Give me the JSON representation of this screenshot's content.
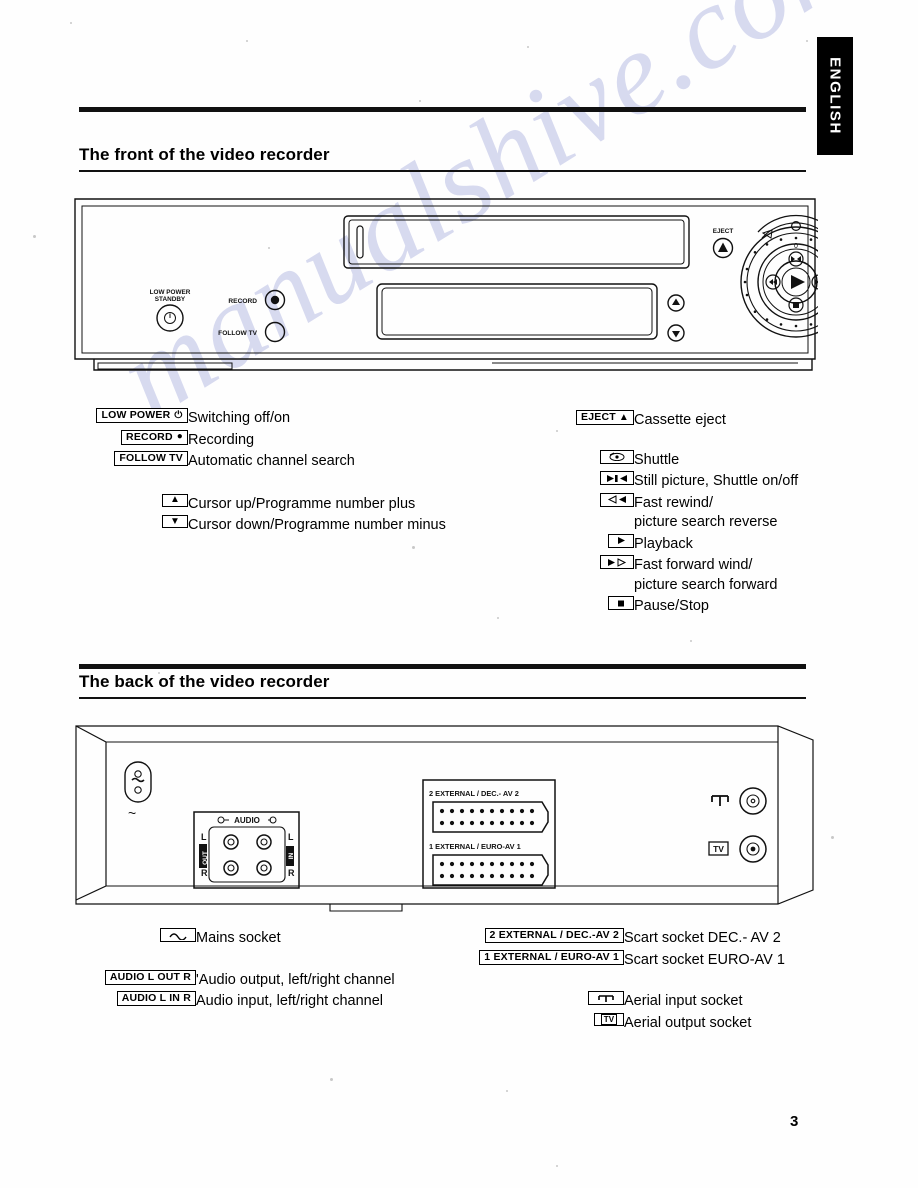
{
  "document": {
    "language_tab": "ENGLISH",
    "page_number": "3",
    "watermark": "manualshive.com"
  },
  "sections": [
    {
      "id": "front",
      "title": "The front of the video recorder"
    },
    {
      "id": "back",
      "title": "The back of the video recorder"
    }
  ],
  "front_panel_art": {
    "labels": {
      "low_power_standby_line1": "LOW POWER",
      "low_power_standby_line2": "STANDBY",
      "record": "RECORD",
      "follow_tv": "FOLLOW TV",
      "eject": "EJECT",
      "shuttle_scale_zero": "0"
    }
  },
  "back_panel_art": {
    "labels": {
      "mains_symbol": "~",
      "audio": "AUDIO",
      "audio_out_l": "L",
      "audio_out_r": "R",
      "audio_out_stack": "OUT",
      "audio_in_l": "L",
      "audio_in_r": "R",
      "audio_in_stack": "IN",
      "scart_av2": "2 EXTERNAL / DEC.- AV 2",
      "scart_av1": "1 EXTERNAL / EURO-AV 1",
      "tv_out": "TV"
    }
  },
  "front_legend_left": [
    {
      "key_label": "LOW POWER",
      "key_glyph": "⏻",
      "key_style": "boxed-wide",
      "text": "Switching off/on"
    },
    {
      "key_label": "RECORD",
      "key_glyph": "●",
      "key_style": "boxed-wide",
      "text": "Recording"
    },
    {
      "key_label": "FOLLOW TV",
      "key_glyph": "",
      "key_style": "boxed-wide",
      "text": "Automatic channel search"
    },
    {
      "key_label": "",
      "key_glyph": "▲",
      "key_style": "boxed-narrow",
      "text": "Cursor up/Programme number plus"
    },
    {
      "key_label": "",
      "key_glyph": "▼",
      "key_style": "boxed-narrow",
      "text": "Cursor down/Programme number minus"
    }
  ],
  "front_legend_right": [
    {
      "key_label": "EJECT",
      "key_glyph": "▲",
      "key_style": "boxed-wide",
      "text": "Cassette eject",
      "text2": ""
    },
    {
      "key_label": "",
      "key_glyph": "shuttle",
      "key_style": "boxed-trans",
      "text": "Shuttle",
      "text2": ""
    },
    {
      "key_label": "",
      "key_glyph": "▶◀",
      "key_style": "boxed-trans",
      "text": "Still picture, Shuttle on/off",
      "text2": ""
    },
    {
      "key_label": "",
      "key_glyph": "◀◀",
      "key_style": "boxed-trans",
      "text": "Fast rewind/",
      "text2": "picture search reverse"
    },
    {
      "key_label": "",
      "key_glyph": "▶",
      "key_style": "boxed-trans",
      "text": "Playback",
      "text2": ""
    },
    {
      "key_label": "",
      "key_glyph": "▶▷",
      "key_style": "boxed-trans",
      "text": "Fast forward wind/",
      "text2": "picture search forward"
    },
    {
      "key_label": "",
      "key_glyph": "◼",
      "key_style": "boxed-trans",
      "text": "Pause/Stop",
      "text2": ""
    }
  ],
  "back_legend_left": [
    {
      "key_label": "",
      "key_glyph": "sine",
      "key_style": "boxed-trans",
      "text": "Mains socket"
    },
    {
      "key_label": "AUDIO L OUT R",
      "key_glyph": "",
      "key_style": "boxed-wide",
      "text": "'Audio output, left/right channel"
    },
    {
      "key_label": "AUDIO L IN R",
      "key_glyph": "",
      "key_style": "boxed-wide",
      "text": "Audio input, left/right channel"
    }
  ],
  "back_legend_right": [
    {
      "key_label": "2 EXTERNAL / DEC.-AV 2",
      "key_glyph": "",
      "key_style": "boxed-wide",
      "text": "Scart socket DEC.- AV 2"
    },
    {
      "key_label": "1 EXTERNAL / EURO-AV 1",
      "key_glyph": "",
      "key_style": "boxed-wide",
      "text": "Scart socket EURO-AV 1"
    },
    {
      "key_label": "",
      "key_glyph": "aerial",
      "key_style": "boxed-trans",
      "text": "Aerial input socket"
    },
    {
      "key_label": "TV",
      "key_glyph": "",
      "key_style": "boxed-narrow",
      "text": "Aerial output socket"
    }
  ]
}
